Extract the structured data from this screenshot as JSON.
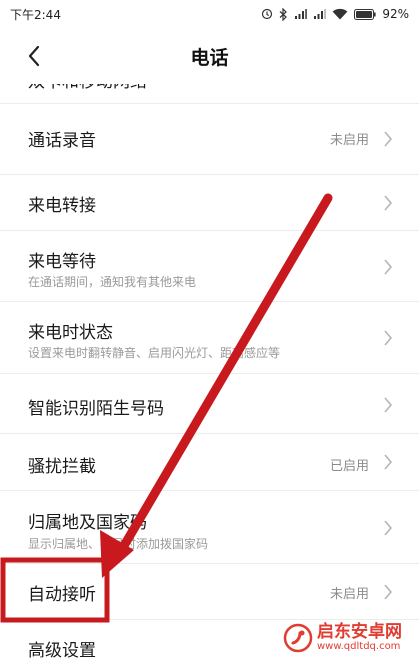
{
  "status_bar": {
    "time": "下午2:44",
    "battery": "92%",
    "icons": [
      "notification-icon",
      "bluetooth-icon",
      "signal-icon",
      "signal-icon",
      "wifi-icon",
      "battery-icon"
    ]
  },
  "header": {
    "title": "电话",
    "back_icon": "chevron-left-icon"
  },
  "items": [
    {
      "title": "双卡和移动网络",
      "subtitle": "",
      "value": ""
    },
    {
      "title": "通话录音",
      "subtitle": "",
      "value": "未启用"
    },
    {
      "title": "来电转接",
      "subtitle": "",
      "value": ""
    },
    {
      "title": "来电等待",
      "subtitle": "在通话期间，通知我有其他来电",
      "value": ""
    },
    {
      "title": "来电时状态",
      "subtitle": "设置来电时翻转静音、启用闪光灯、距离感应等",
      "value": ""
    },
    {
      "title": "智能识别陌生号码",
      "subtitle": "",
      "value": ""
    },
    {
      "title": "骚扰拦截",
      "subtitle": "",
      "value": "已启用"
    },
    {
      "title": "归属地及国家码",
      "subtitle": "显示归属地、拨号时添加拨国家码",
      "value": ""
    },
    {
      "title": "自动接听",
      "subtitle": "",
      "value": "未启用"
    },
    {
      "title": "高级设置",
      "subtitle": "",
      "value": ""
    }
  ],
  "annotation": {
    "highlight_color": "#c8191e",
    "arrow_color": "#c8191e"
  },
  "watermark": {
    "name": "启东安卓网",
    "url": "www.qdltdq.com"
  }
}
